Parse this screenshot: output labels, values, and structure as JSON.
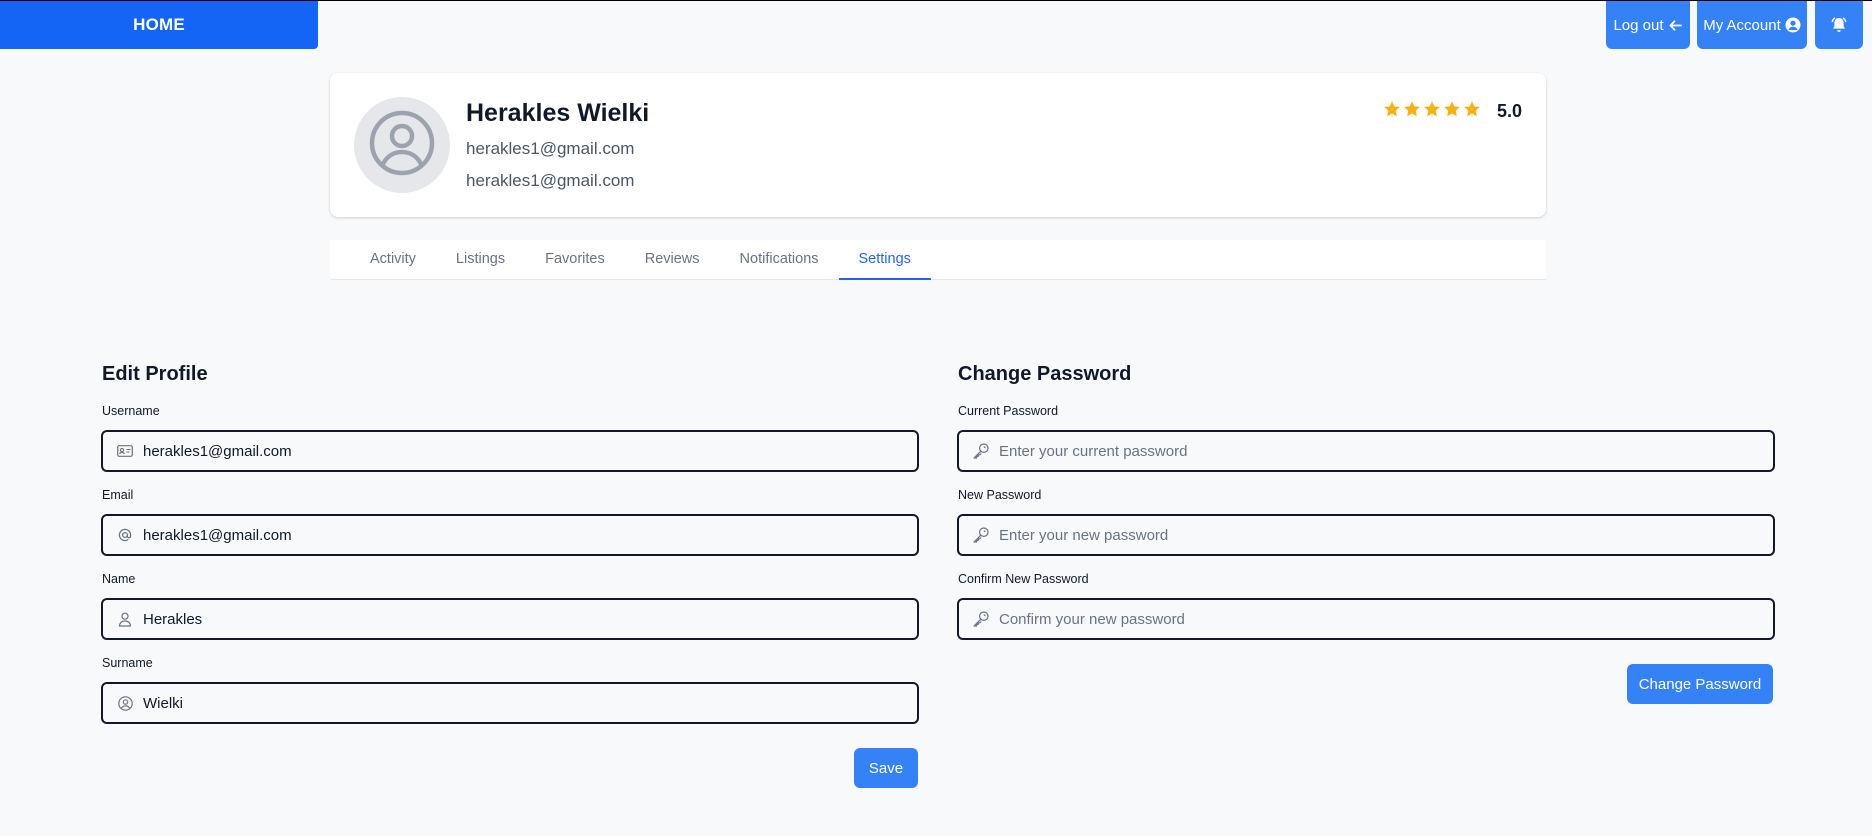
{
  "nav": {
    "home_label": "HOME",
    "logout_label": "Log out",
    "account_label": "My Account"
  },
  "profile": {
    "name": "Herakles Wielki",
    "email": "herakles1@gmail.com",
    "username": "herakles1@gmail.com",
    "rating": "5.0",
    "stars": 5,
    "star_color": "#f5b014"
  },
  "tabs": [
    "Activity",
    "Listings",
    "Favorites",
    "Reviews",
    "Notifications",
    "Settings"
  ],
  "active_tab": "Settings",
  "edit_profile": {
    "title": "Edit Profile",
    "username_label": "Username",
    "username_value": "herakles1@gmail.com",
    "email_label": "Email",
    "email_value": "herakles1@gmail.com",
    "name_label": "Name",
    "name_value": "Herakles",
    "surname_label": "Surname",
    "surname_value": "Wielki",
    "save_label": "Save"
  },
  "change_password": {
    "title": "Change Password",
    "current_label": "Current Password",
    "current_placeholder": "Enter your current password",
    "new_label": "New Password",
    "new_placeholder": "Enter your new password",
    "confirm_label": "Confirm New Password",
    "confirm_placeholder": "Confirm your new password",
    "button_label": "Change Password"
  },
  "colors": {
    "primary": "#1464f6",
    "button": "#3482f6",
    "active_tab": "#2563eb"
  }
}
